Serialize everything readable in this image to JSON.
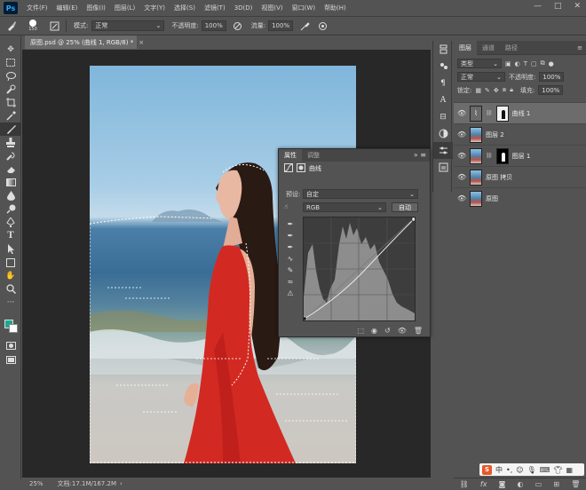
{
  "app": {
    "logo": "Ps"
  },
  "menu": [
    "文件(F)",
    "编辑(E)",
    "图像(I)",
    "图层(L)",
    "文字(Y)",
    "选择(S)",
    "滤镜(T)",
    "3D(D)",
    "视图(V)",
    "窗口(W)",
    "帮助(H)"
  ],
  "window_controls": [
    "—",
    "□",
    "✕"
  ],
  "options": {
    "brush_size": "150",
    "mode_label": "模式:",
    "mode_value": "正常",
    "opacity_label": "不透明度:",
    "opacity_value": "100%",
    "flow_label": "流量:",
    "flow_value": "100%"
  },
  "document": {
    "tab_title": "原图.psd @ 25% (曲线 1, RGB/8) *",
    "zoom": "25%",
    "doc_info": "文档:17.1M/167.2M"
  },
  "toolbar": [
    "move",
    "marquee",
    "lasso",
    "quick-select",
    "crop",
    "eyedropper",
    "healing",
    "brush",
    "stamp",
    "history-brush",
    "eraser",
    "gradient",
    "blur",
    "dodge",
    "pen",
    "type",
    "path-select",
    "shape",
    "hand",
    "zoom",
    "more"
  ],
  "colors": {
    "foreground": "#1fa690",
    "background": "#ffffff"
  },
  "layers_panel": {
    "tabs": [
      "图层",
      "通道",
      "路径"
    ],
    "filter_label": "类型",
    "blend_mode": "正常",
    "opacity_label": "不透明度:",
    "opacity_value": "100%",
    "lock_label": "锁定:",
    "fill_label": "填充:",
    "fill_value": "100%",
    "layers": [
      {
        "name": "曲线 1",
        "selected": true,
        "type": "curves"
      },
      {
        "name": "图层 2",
        "selected": false,
        "type": "photo"
      },
      {
        "name": "图层 1",
        "selected": false,
        "type": "photo-mask"
      },
      {
        "name": "原图 拷贝",
        "selected": false,
        "type": "photo"
      },
      {
        "name": "原图",
        "selected": false,
        "type": "photo"
      }
    ]
  },
  "properties": {
    "tabs": [
      "属性",
      "调整"
    ],
    "title": "曲线",
    "preset_label": "预设:",
    "preset_value": "自定",
    "channel_value": "RGB",
    "auto_label": "自动"
  },
  "ime": {
    "badge": "S",
    "text": "中"
  }
}
